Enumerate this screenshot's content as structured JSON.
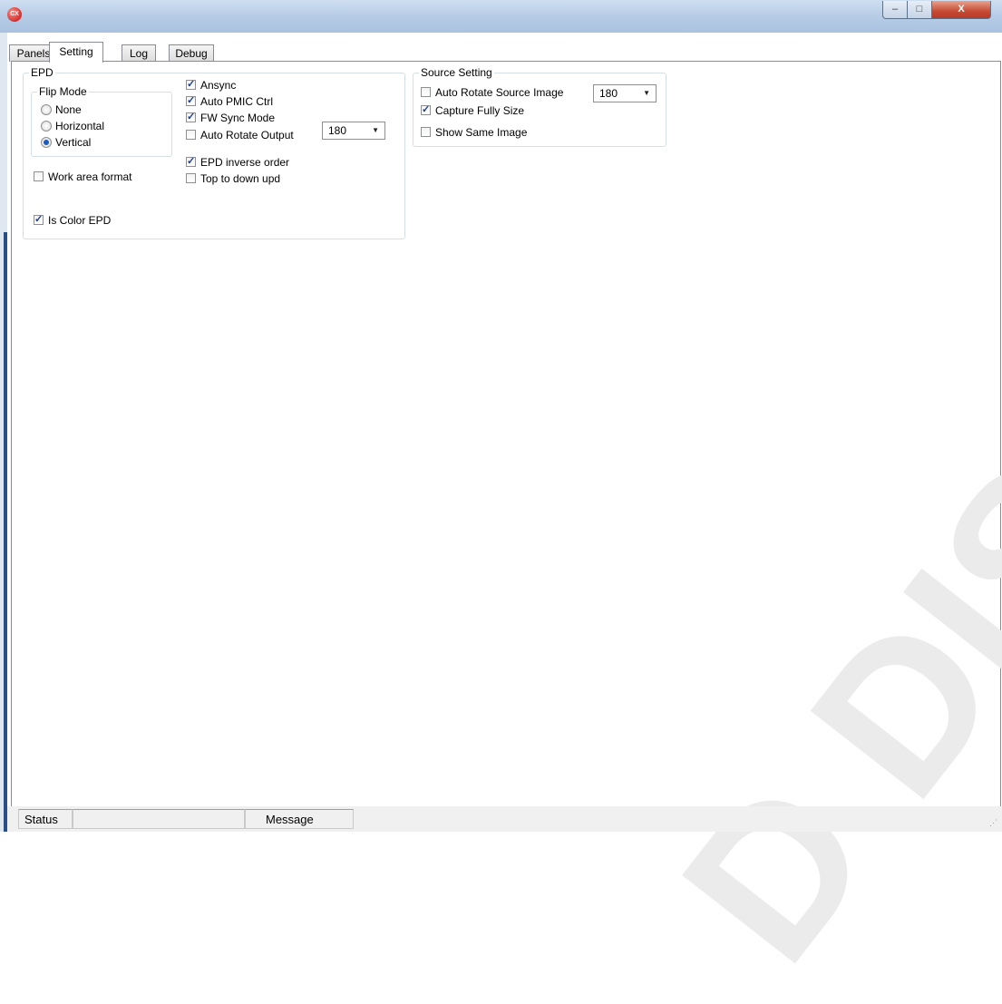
{
  "app": {
    "icon_text": "CX"
  },
  "window_buttons": {
    "minimize": "–",
    "maximize": "□",
    "close": "X"
  },
  "tabs": [
    {
      "label": "Panels",
      "active": false
    },
    {
      "label": "Setting",
      "active": true
    },
    {
      "label": "Log",
      "active": false
    },
    {
      "label": "Debug",
      "active": false
    }
  ],
  "epd": {
    "title": "EPD",
    "flip_mode": {
      "title": "Flip Mode",
      "options": [
        {
          "label": "None",
          "selected": false
        },
        {
          "label": "Horizontal",
          "selected": false
        },
        {
          "label": "Vertical",
          "selected": true
        }
      ]
    },
    "work_area_format": {
      "label": "Work area format",
      "checked": false
    },
    "is_color_epd": {
      "label": "Is Color EPD",
      "checked": true
    },
    "ansync": {
      "label": "Ansync",
      "checked": true
    },
    "auto_pmic_ctrl": {
      "label": "Auto PMIC Ctrl",
      "checked": true
    },
    "fw_sync_mode": {
      "label": "FW Sync Mode",
      "checked": true
    },
    "auto_rotate_output": {
      "label": "Auto Rotate Output",
      "checked": false
    },
    "rotate_select": {
      "value": "180"
    },
    "epd_inverse_order": {
      "label": "EPD inverse order",
      "checked": true
    },
    "top_to_down_upd": {
      "label": "Top to down upd",
      "checked": false
    }
  },
  "source": {
    "title": "Source Setting",
    "auto_rotate_source_image": {
      "label": "Auto Rotate Source Image",
      "checked": false
    },
    "rotate_select": {
      "value": "180"
    },
    "capture_fully_size": {
      "label": "Capture Fully Size",
      "checked": true
    },
    "show_same_image": {
      "label": "Show Same Image",
      "checked": false
    }
  },
  "status_bar": {
    "status": "Status",
    "message": "Message"
  },
  "watermark": {
    "text": "D DISPLAY"
  },
  "glyphs": {
    "check": "✓",
    "dropdown": "▼"
  }
}
